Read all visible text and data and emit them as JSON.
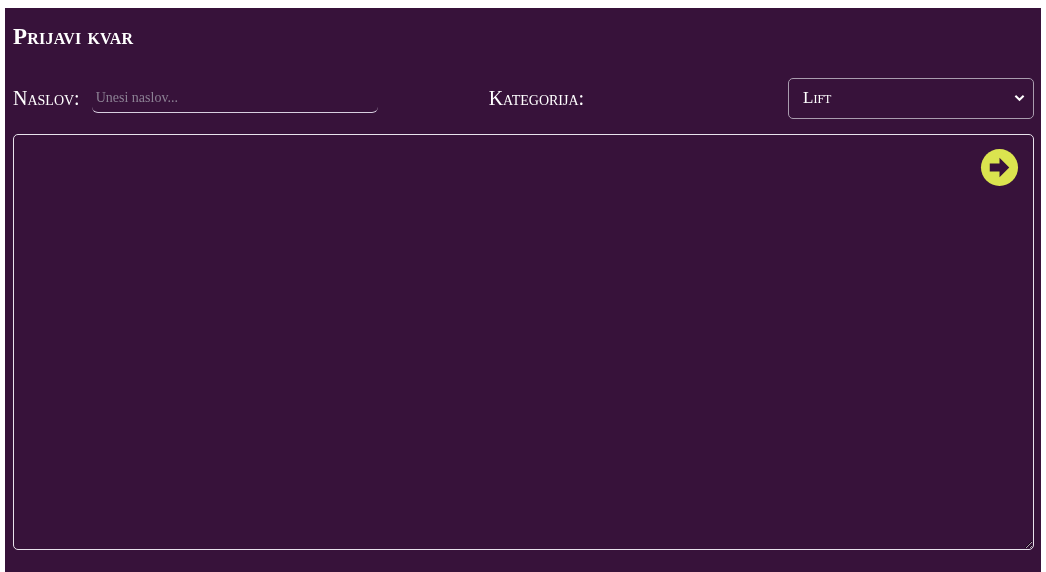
{
  "title": "Prijavi kvar",
  "title_field": {
    "label": "Naslov:",
    "placeholder": "Unesi naslov..."
  },
  "category": {
    "label": "Kategorija:",
    "value": "Lift"
  }
}
